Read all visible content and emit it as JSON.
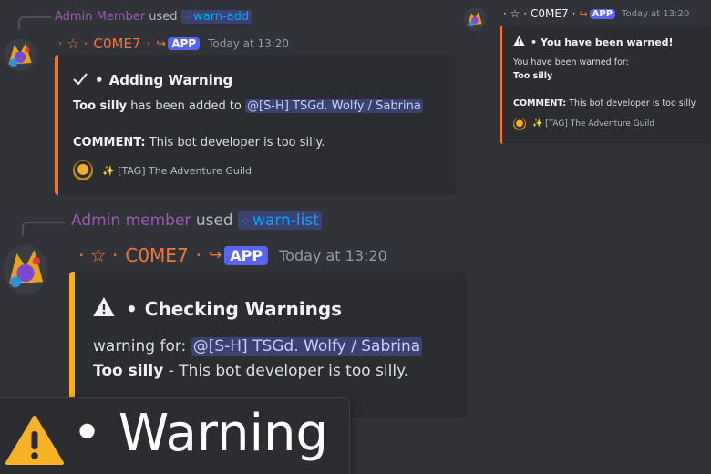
{
  "msg1": {
    "reply_user": "Admin Member",
    "reply_used": "used",
    "reply_command": "warn-add",
    "prefix": "· ☆ ·",
    "bot_name": "C0ME7",
    "sep": "·",
    "app_badge": "APP",
    "timestamp": "Today at 13:20",
    "embed_title": "Adding Warning",
    "reason": "Too silly",
    "added_text": "has been added to",
    "target": "@[S-H] TSGd. Wolfy / Sabrina",
    "comment_label": "COMMENT:",
    "comment_text": "This bot developer is too silly.",
    "footer": "✨ [TAG] The Adventure Guild",
    "accent": "#f0753b"
  },
  "msg2": {
    "reply_user": "Admin member",
    "reply_used": "used",
    "reply_command": "warn-list",
    "prefix": "· ☆ ·",
    "bot_name": "C0ME7",
    "sep": "·",
    "app_badge": "APP",
    "timestamp": "Today at 13:20",
    "embed_title": "Checking Warnings",
    "warning_for_label": "warning for:",
    "target": "@[S-H] TSGd. Wolfy / Sabrina",
    "reason": "Too silly",
    "reason_text": "- This bot developer is too silly.",
    "accent": "#fbb01b"
  },
  "dm": {
    "prefix": "· ☆ ·",
    "bot_name": "C0ME7",
    "sep": "·",
    "app_badge": "APP",
    "timestamp": "Today at 13:20",
    "embed_title": "You have been warned!",
    "warned_for": "You have been warned for:",
    "reason": "Too silly",
    "comment_label": "COMMENT:",
    "comment_text": "This bot developer is too silly.",
    "footer": "✨ [TAG] The Adventure Guild"
  },
  "toast": {
    "text": "• Warning",
    "icon": "warning-icon"
  }
}
